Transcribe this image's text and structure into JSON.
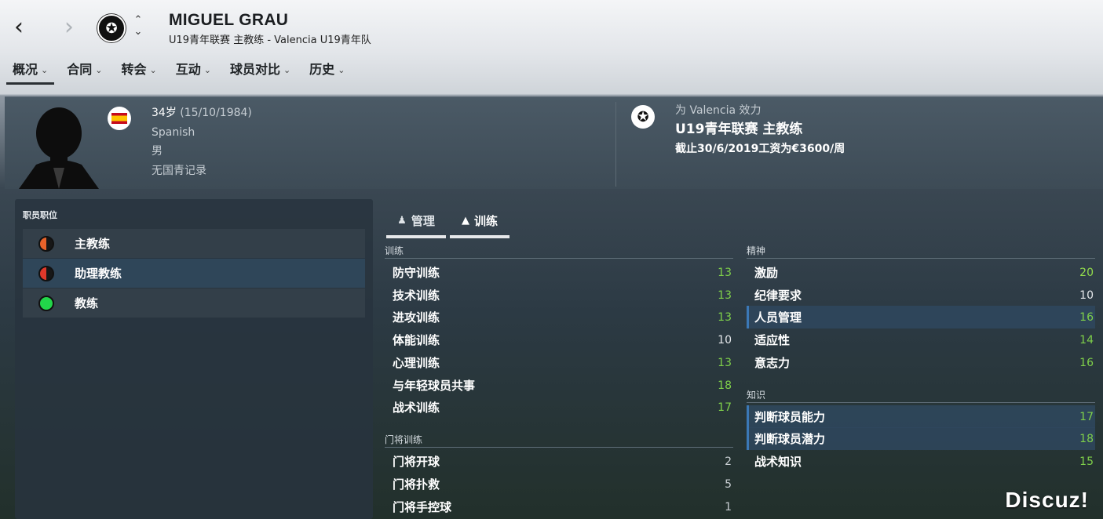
{
  "header": {
    "back_icon": "‹",
    "forward_icon": "›",
    "club_badge_icon": "✪",
    "updown_icon": "⌃⌄",
    "name": "MIGUEL GRAU",
    "subtitle": "U19青年联赛 主教练 - Valencia U19青年队"
  },
  "tabs": [
    {
      "label": "概况",
      "active": true
    },
    {
      "label": "合同"
    },
    {
      "label": "转会"
    },
    {
      "label": "互动"
    },
    {
      "label": "球员对比"
    },
    {
      "label": "历史"
    }
  ],
  "profile": {
    "age": "34岁",
    "dob": "(15/10/1984)",
    "nationality": "Spanish",
    "gender": "男",
    "youth_record": "无国青记录",
    "club_line": "为 Valencia 效力",
    "role": "U19青年联赛 主教练",
    "contract": "截止30/6/2019工资为€3600/周"
  },
  "roles_panel": {
    "title": "职员职位",
    "items": [
      {
        "label": "主教练",
        "dot": "half"
      },
      {
        "label": "助理教练",
        "dot": "half2",
        "selected": true
      },
      {
        "label": "教练",
        "dot": "green"
      }
    ]
  },
  "subtabs": [
    {
      "label": "管理",
      "icon": "♟"
    },
    {
      "label": "训练",
      "icon": "▲",
      "active": true
    }
  ],
  "training": {
    "title": "训练",
    "items": [
      {
        "label": "防守训练",
        "value": "13"
      },
      {
        "label": "技术训练",
        "value": "13"
      },
      {
        "label": "进攻训练",
        "value": "13"
      },
      {
        "label": "体能训练",
        "value": "10"
      },
      {
        "label": "心理训练",
        "value": "13"
      },
      {
        "label": "与年轻球员共事",
        "value": "18"
      },
      {
        "label": "战术训练",
        "value": "17"
      }
    ]
  },
  "gk_training": {
    "title": "门将训练",
    "items": [
      {
        "label": "门将开球",
        "value": "2"
      },
      {
        "label": "门将扑救",
        "value": "5"
      },
      {
        "label": "门将手控球",
        "value": "1"
      }
    ]
  },
  "mental": {
    "title": "精神",
    "items": [
      {
        "label": "激励",
        "value": "20"
      },
      {
        "label": "纪律要求",
        "value": "10"
      },
      {
        "label": "人员管理",
        "value": "16"
      },
      {
        "label": "适应性",
        "value": "14"
      },
      {
        "label": "意志力",
        "value": "16"
      }
    ]
  },
  "knowledge": {
    "title": "知识",
    "items": [
      {
        "label": "判断球员能力",
        "value": "17"
      },
      {
        "label": "判断球员潜力",
        "value": "18"
      },
      {
        "label": "战术知识",
        "value": "15"
      }
    ]
  },
  "watermark": "Discuz!",
  "colors": {
    "good": "#7fd04a",
    "accent": "#3b78b6"
  }
}
